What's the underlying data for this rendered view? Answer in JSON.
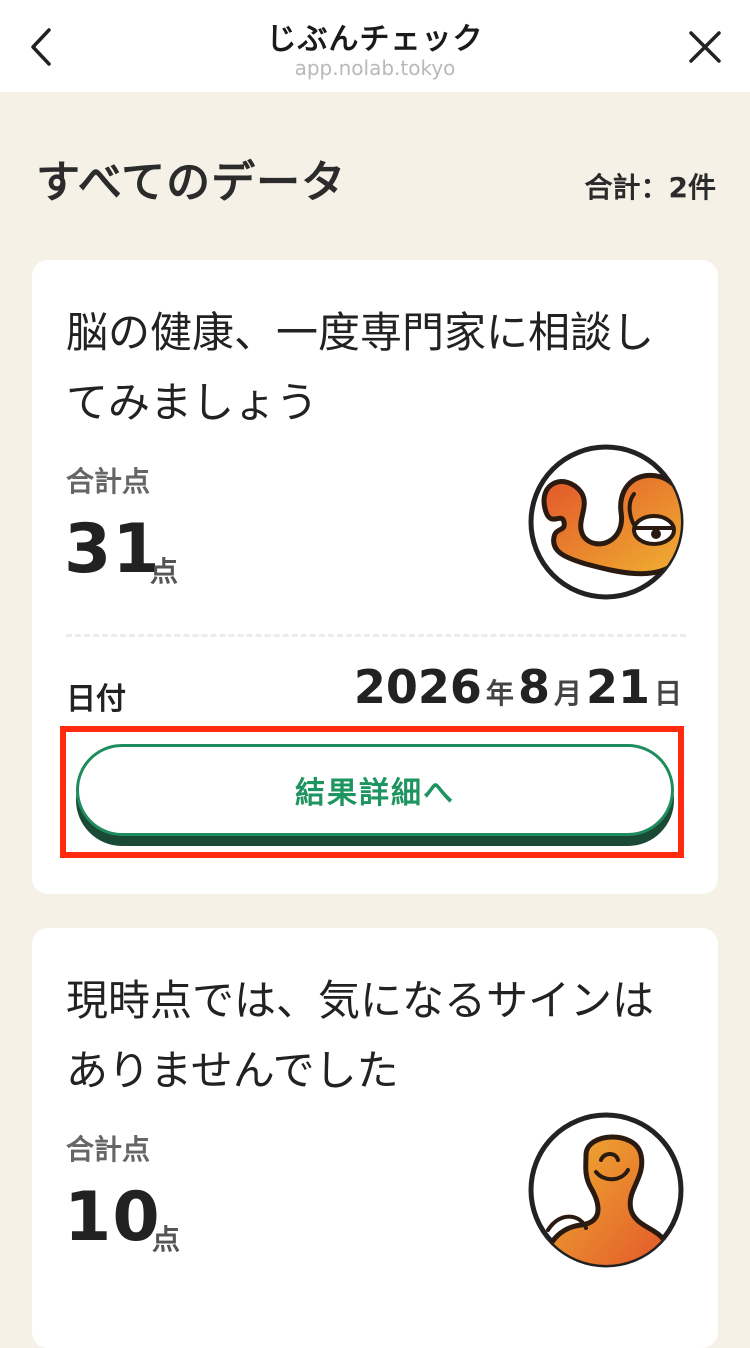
{
  "nav": {
    "title": "じぶんチェック",
    "url": "app.nolab.tokyo"
  },
  "header": {
    "title": "すべてのデータ",
    "total": "合計：2件"
  },
  "cards": [
    {
      "title": "脳の健康、一度専門家に相談してみましょう",
      "score_label": "合計点",
      "score": "31",
      "score_unit": "点",
      "date_label": "日付",
      "date_year": "2026",
      "date_year_unit": "年",
      "date_month": "8",
      "date_month_unit": "月",
      "date_day": "21",
      "date_day_unit": "日",
      "button_label": "結果詳細へ",
      "mascot_icon": "sleepy-octopus-mascot-icon"
    },
    {
      "title": "現時点では、気になるサインはありませんでした",
      "score_label": "合計点",
      "score": "10",
      "score_unit": "点",
      "mascot_icon": "happy-octopus-mascot-icon"
    }
  ],
  "colors": {
    "background": "#f6f1e6",
    "accent_green": "#1e9460",
    "highlight_red": "#ff2a10",
    "mascot_orange": "#e58a2a"
  }
}
